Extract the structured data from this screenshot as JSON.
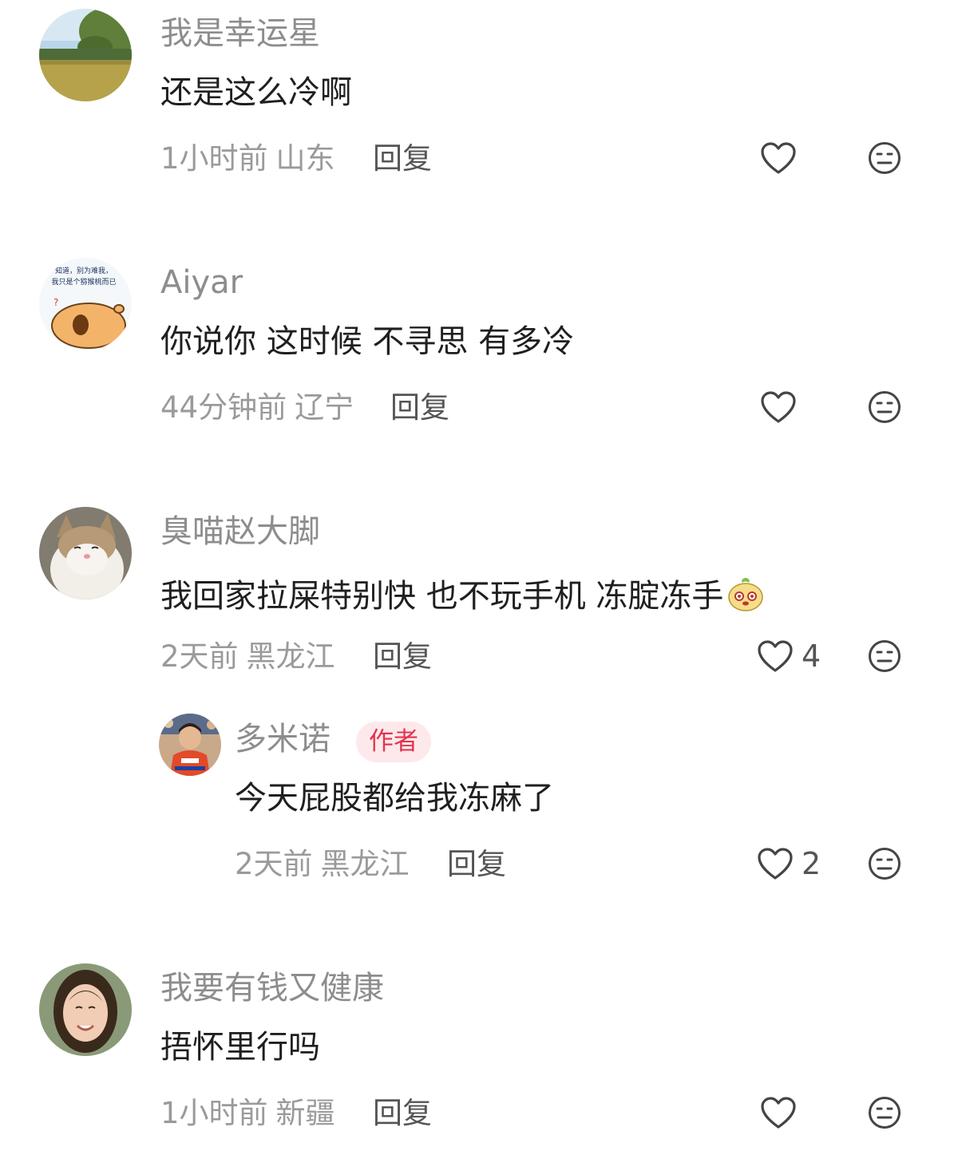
{
  "comments": [
    {
      "username": "我是幸运星",
      "text": "还是这么冷啊",
      "time": "1小时前",
      "location": "山东",
      "reply_label": "回复",
      "likes": "",
      "avatar_icon": "meadow-landscape-avatar"
    },
    {
      "username": "Aiyar",
      "text": "你说你 这时候 不寻思 有多冷",
      "time": "44分钟前",
      "location": "辽宁",
      "reply_label": "回复",
      "likes": "",
      "avatar_icon": "capybara-meme-avatar",
      "avatar_caption": [
        "知道，别为难我，",
        "我只是个猕猴桃而已"
      ]
    },
    {
      "username": "臭喵赵大脚",
      "text": "我回家拉屎特别快 也不玩手机 冻腚冻手",
      "emoji_icon": "cute-bun-emoji",
      "time": "2天前",
      "location": "黑龙江",
      "reply_label": "回复",
      "likes": "4",
      "avatar_icon": "cat-avatar",
      "replies": [
        {
          "username": "多米诺",
          "badge": "作者",
          "text": "今天屁股都给我冻麻了",
          "time": "2天前",
          "location": "黑龙江",
          "reply_label": "回复",
          "likes": "2",
          "avatar_icon": "racer-avatar"
        }
      ]
    },
    {
      "username": "我要有钱又健康",
      "text": "捂怀里行吗",
      "time": "1小时前",
      "location": "新疆",
      "reply_label": "回复",
      "likes": "",
      "avatar_icon": "woman-portrait-avatar"
    }
  ],
  "colors": {
    "username": "#8d8d8d",
    "text": "#1f1f1f",
    "meta": "#9a9a9a",
    "reply": "#555555",
    "badge_bg": "#fde9ec",
    "badge_text": "#e2344f",
    "icon_stroke": "#444444"
  }
}
